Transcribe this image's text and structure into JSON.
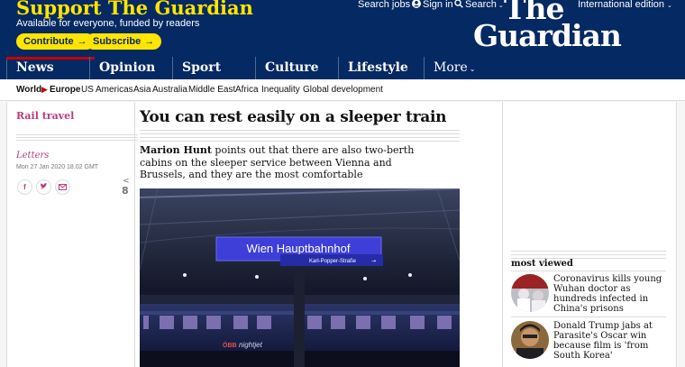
{
  "header": {
    "support_title": "Support The Guardian",
    "support_subtitle": "Available for everyone, funded by readers",
    "contribute_label": "Contribute",
    "subscribe_label": "Subscribe",
    "arrow": "→",
    "search_jobs": "Search jobs",
    "sign_in": "Sign in",
    "search": "Search",
    "edition": "International edition",
    "logo_line1": "The",
    "logo_line2": "Guardian",
    "brand_color": "#052962",
    "accent_color": "#ffe500"
  },
  "pillars": [
    {
      "label": "News"
    },
    {
      "label": "Opinion"
    },
    {
      "label": "Sport"
    },
    {
      "label": "Culture"
    },
    {
      "label": "Lifestyle"
    },
    {
      "label": "More"
    }
  ],
  "subnav": {
    "world": "World",
    "europe": "Europe",
    "items": [
      "US",
      "Americas",
      "Asia",
      "Australia",
      "Middle East",
      "Africa",
      "Inequality",
      "Global development"
    ]
  },
  "article": {
    "section": "Rail travel",
    "series": "Letters",
    "dateline": "Mon 27 Jan 2020 18.02 GMT",
    "share_count": "8",
    "headline": "You can rest easily on a sleeper train",
    "standfirst_author": "Marion Hunt",
    "standfirst_text": " points out that there are also two-berth cabins on the sleeper service between Vienna and Brussels, and they are the most comfortable",
    "photo": {
      "sign_main": "Wien Hauptbahnhof",
      "sign_sub": "Karl-Popper-Straße",
      "sign_arrow": "→",
      "train_brand": "nightjet",
      "train_logo": "ÖBB"
    }
  },
  "most_viewed": {
    "title": "most viewed",
    "items": [
      {
        "text": "Coronavirus kills young Wuhan doctor as hundreds infected in China's prisons"
      },
      {
        "text": "Donald Trump jabs at Parasite's Oscar win because film is 'from South Korea'"
      }
    ]
  }
}
